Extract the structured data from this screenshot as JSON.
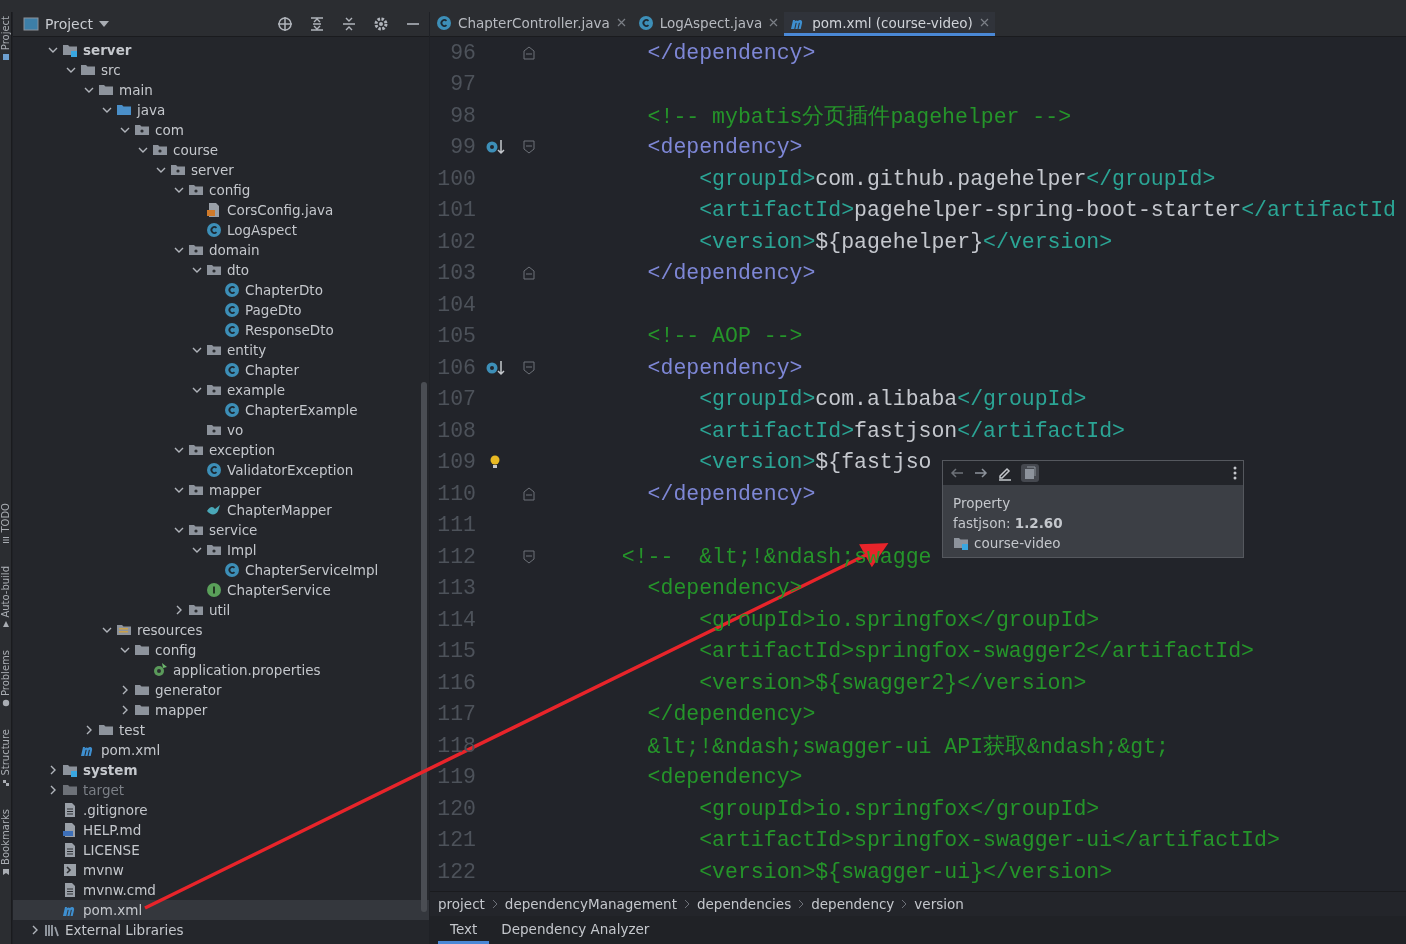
{
  "tool_strip": [
    {
      "label": "Project",
      "kind": "project"
    },
    {
      "label": "TODO",
      "kind": "list"
    },
    {
      "label": "Auto-build",
      "kind": "build"
    },
    {
      "label": "Problems",
      "kind": "problems"
    },
    {
      "label": "Structure",
      "kind": "structure"
    },
    {
      "label": "Bookmarks",
      "kind": "bookmark"
    }
  ],
  "project_panel": {
    "title": "Project",
    "tree": {
      "items": [
        {
          "label": "server",
          "kind": "module",
          "expanded": true,
          "selected": false,
          "children": [
            {
              "label": "src",
              "kind": "folder",
              "expanded": true,
              "selected": false,
              "children": [
                {
                  "label": "main",
                  "kind": "folder",
                  "expanded": true,
                  "selected": false,
                  "children": [
                    {
                      "label": "java",
                      "kind": "source",
                      "expanded": true,
                      "selected": false,
                      "children": [
                        {
                          "label": "com",
                          "kind": "package",
                          "expanded": true,
                          "selected": false,
                          "children": [
                            {
                              "label": "course",
                              "kind": "package",
                              "expanded": true,
                              "selected": false,
                              "children": [
                                {
                                  "label": "server",
                                  "kind": "package",
                                  "expanded": true,
                                  "selected": false,
                                  "children": [
                                    {
                                      "label": "config",
                                      "kind": "package",
                                      "expanded": true,
                                      "selected": false,
                                      "children": [
                                        {
                                          "label": "CorsConfig.java",
                                          "kind": "javafile",
                                          "selected": false
                                        },
                                        {
                                          "label": "LogAspect",
                                          "kind": "class",
                                          "selected": false
                                        }
                                      ]
                                    },
                                    {
                                      "label": "domain",
                                      "kind": "package",
                                      "expanded": true,
                                      "selected": false,
                                      "children": [
                                        {
                                          "label": "dto",
                                          "kind": "package",
                                          "expanded": true,
                                          "selected": false,
                                          "children": [
                                            {
                                              "label": "ChapterDto",
                                              "kind": "class",
                                              "selected": false
                                            },
                                            {
                                              "label": "PageDto",
                                              "kind": "class",
                                              "selected": false
                                            },
                                            {
                                              "label": "ResponseDto",
                                              "kind": "class",
                                              "selected": false
                                            }
                                          ]
                                        },
                                        {
                                          "label": "entity",
                                          "kind": "package",
                                          "expanded": true,
                                          "selected": false,
                                          "children": [
                                            {
                                              "label": "Chapter",
                                              "kind": "class",
                                              "selected": false
                                            }
                                          ]
                                        },
                                        {
                                          "label": "example",
                                          "kind": "package",
                                          "expanded": true,
                                          "selected": false,
                                          "children": [
                                            {
                                              "label": "ChapterExample",
                                              "kind": "class",
                                              "selected": false
                                            }
                                          ]
                                        },
                                        {
                                          "label": "vo",
                                          "kind": "package",
                                          "selected": false
                                        }
                                      ]
                                    },
                                    {
                                      "label": "exception",
                                      "kind": "package",
                                      "expanded": true,
                                      "selected": false,
                                      "children": [
                                        {
                                          "label": "ValidatorException",
                                          "kind": "class",
                                          "selected": false
                                        }
                                      ]
                                    },
                                    {
                                      "label": "mapper",
                                      "kind": "package",
                                      "expanded": true,
                                      "selected": false,
                                      "children": [
                                        {
                                          "label": "ChapterMapper",
                                          "kind": "mapper",
                                          "selected": false
                                        }
                                      ]
                                    },
                                    {
                                      "label": "service",
                                      "kind": "package",
                                      "expanded": true,
                                      "selected": false,
                                      "children": [
                                        {
                                          "label": "Impl",
                                          "kind": "package",
                                          "expanded": true,
                                          "selected": false,
                                          "children": [
                                            {
                                              "label": "ChapterServiceImpl",
                                              "kind": "class",
                                              "selected": false
                                            }
                                          ]
                                        },
                                        {
                                          "label": "ChapterService",
                                          "kind": "interface",
                                          "selected": false
                                        }
                                      ]
                                    },
                                    {
                                      "label": "util",
                                      "kind": "package",
                                      "expanded": false,
                                      "selected": false
                                    }
                                  ]
                                }
                              ]
                            }
                          ]
                        }
                      ]
                    },
                    {
                      "label": "resources",
                      "kind": "resources",
                      "expanded": true,
                      "selected": false,
                      "children": [
                        {
                          "label": "config",
                          "kind": "folder",
                          "expanded": true,
                          "selected": false,
                          "children": [
                            {
                              "label": "application.properties",
                              "kind": "properties",
                              "selected": false
                            }
                          ]
                        },
                        {
                          "label": "generator",
                          "kind": "folder",
                          "expanded": false,
                          "selected": false
                        },
                        {
                          "label": "mapper",
                          "kind": "folder",
                          "expanded": false,
                          "selected": false
                        }
                      ]
                    }
                  ]
                },
                {
                  "label": "test",
                  "kind": "folder",
                  "expanded": false,
                  "selected": false
                }
              ]
            },
            {
              "label": "pom.xml",
              "kind": "maven",
              "selected": false
            }
          ]
        },
        {
          "label": "system",
          "kind": "module",
          "expanded": false,
          "selected": false
        },
        {
          "label": "target",
          "kind": "excluded",
          "expanded": false,
          "selected": false
        },
        {
          "label": ".gitignore",
          "kind": "file",
          "selected": false
        },
        {
          "label": "HELP.md",
          "kind": "markdown",
          "selected": false
        },
        {
          "label": "LICENSE",
          "kind": "file",
          "selected": false
        },
        {
          "label": "mvnw",
          "kind": "script",
          "selected": false
        },
        {
          "label": "mvnw.cmd",
          "kind": "file",
          "selected": false
        },
        {
          "label": "pom.xml",
          "kind": "maven",
          "selected": true
        }
      ],
      "libraries": {
        "label": "External Libraries",
        "expanded": false,
        "selected": false
      }
    }
  },
  "editor": {
    "tabs": [
      {
        "label": "ChapterController.java",
        "kind": "class",
        "selected": false
      },
      {
        "label": "LogAspect.java",
        "kind": "class",
        "selected": false
      },
      {
        "label": "pom.xml (course-video)",
        "kind": "maven",
        "selected": true
      }
    ],
    "lines": [
      {
        "number": "96",
        "gutter_icons": [
          {
            "kind": "fold_end"
          }
        ],
        "code": [
          {
            "kind": "tag",
            "text": "    </dependency>"
          }
        ]
      },
      {
        "number": "97"
      },
      {
        "number": "98",
        "code": [
          {
            "kind": "comment",
            "text": "    <!-- mybatis分页插件pagehelper -->"
          }
        ]
      },
      {
        "number": "99",
        "gutter_icons": [
          {
            "kind": "navigate"
          },
          {
            "kind": "fold_start"
          }
        ],
        "code": [
          {
            "kind": "tag",
            "text": "    <dependency>"
          }
        ]
      },
      {
        "number": "100",
        "code": [
          {
            "kind": "subtag",
            "text": "        <groupId>"
          },
          {
            "kind": "text",
            "text": "com.github.pagehelper"
          },
          {
            "kind": "subtag",
            "text": "</groupId>"
          }
        ]
      },
      {
        "number": "101",
        "code": [
          {
            "kind": "subtag",
            "text": "        <artifactId>"
          },
          {
            "kind": "text",
            "text": "pagehelper-spring-boot-starter"
          },
          {
            "kind": "subtag",
            "text": "</artifactId"
          }
        ]
      },
      {
        "number": "102",
        "code": [
          {
            "kind": "subtag",
            "text": "        <version>"
          },
          {
            "kind": "text",
            "text": "${pagehelper}"
          },
          {
            "kind": "subtag",
            "text": "</version>"
          }
        ]
      },
      {
        "number": "103",
        "gutter_icons": [
          {
            "kind": "fold_end"
          }
        ],
        "code": [
          {
            "kind": "tag",
            "text": "    </dependency>"
          }
        ]
      },
      {
        "number": "104"
      },
      {
        "number": "105",
        "code": [
          {
            "kind": "comment",
            "text": "    <!-- AOP -->"
          }
        ]
      },
      {
        "number": "106",
        "gutter_icons": [
          {
            "kind": "navigate"
          },
          {
            "kind": "fold_start"
          }
        ],
        "code": [
          {
            "kind": "tag",
            "text": "    <dependency>"
          }
        ]
      },
      {
        "number": "107",
        "code": [
          {
            "kind": "subtag",
            "text": "        <groupId>"
          },
          {
            "kind": "text",
            "text": "com.alibaba"
          },
          {
            "kind": "subtag",
            "text": "</groupId>"
          }
        ]
      },
      {
        "number": "108",
        "code": [
          {
            "kind": "subtag",
            "text": "        <artifactId>"
          },
          {
            "kind": "text",
            "text": "fastjson"
          },
          {
            "kind": "subtag",
            "text": "</artifactId>"
          }
        ]
      },
      {
        "number": "109",
        "gutter_icons": [
          {
            "kind": "bulb"
          }
        ],
        "code": [
          {
            "kind": "subtag",
            "text": "        <version>"
          },
          {
            "kind": "text",
            "text": "${fastjso"
          }
        ]
      },
      {
        "number": "110",
        "gutter_icons": [
          {
            "kind": "fold_end"
          }
        ],
        "code": [
          {
            "kind": "tag",
            "text": "    </dependency>"
          }
        ]
      },
      {
        "number": "111"
      },
      {
        "number": "112",
        "gutter_icons": [
          {
            "kind": "fold_start"
          }
        ],
        "code": [
          {
            "kind": "comment",
            "text": "  <!--  &lt;!&ndash;swagge"
          }
        ]
      },
      {
        "number": "113",
        "code": [
          {
            "kind": "comment",
            "text": "    <dependency>"
          }
        ]
      },
      {
        "number": "114",
        "code": [
          {
            "kind": "comment",
            "text": "        <groupId>io.springfox</groupId>"
          }
        ]
      },
      {
        "number": "115",
        "code": [
          {
            "kind": "comment",
            "text": "        <artifactId>springfox-swagger2</artifactId>"
          }
        ]
      },
      {
        "number": "116",
        "code": [
          {
            "kind": "comment",
            "text": "        <version>${swagger2}</version>"
          }
        ]
      },
      {
        "number": "117",
        "code": [
          {
            "kind": "comment",
            "text": "    </dependency>"
          }
        ]
      },
      {
        "number": "118",
        "code": [
          {
            "kind": "comment",
            "text": "    &lt;!&ndash;swagger-ui API获取&ndash;&gt;"
          }
        ]
      },
      {
        "number": "119",
        "code": [
          {
            "kind": "comment",
            "text": "    <dependency>"
          }
        ]
      },
      {
        "number": "120",
        "code": [
          {
            "kind": "comment",
            "text": "        <groupId>io.springfox</groupId>"
          }
        ]
      },
      {
        "number": "121",
        "code": [
          {
            "kind": "comment",
            "text": "        <artifactId>springfox-swagger-ui</artifactId>"
          }
        ]
      },
      {
        "number": "122",
        "code": [
          {
            "kind": "comment",
            "text": "        <version>${swagger-ui}</version>"
          }
        ]
      }
    ],
    "popup": {
      "heading": "Property",
      "value": "fastjson: **1.2.60**",
      "module": "course-video"
    },
    "breadcrumbs": [
      "project",
      "dependencyManagement",
      "dependencies",
      "dependency",
      "version"
    ],
    "bottom_tabs": [
      {
        "label": "Text",
        "selected": true
      },
      {
        "label": "Dependency Analyzer",
        "selected": false
      }
    ]
  }
}
